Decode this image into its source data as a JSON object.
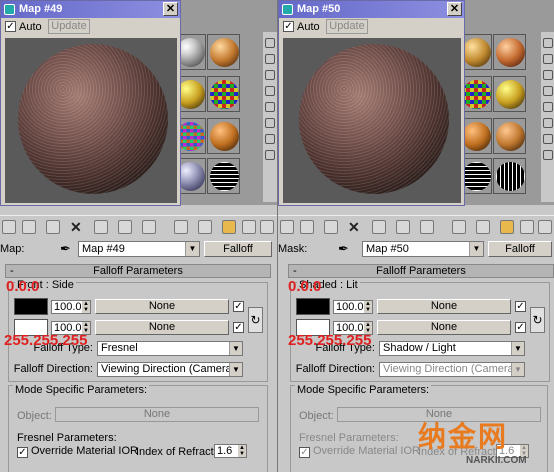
{
  "left": {
    "window_title": "Map #49",
    "auto_label": "Auto",
    "update_label": "Update",
    "close_glyph": "✕",
    "map_label": "Map:",
    "map_select": "Map #49",
    "type_button": "Falloff",
    "rollout_title": "Falloff Parameters",
    "rollout_minus": "-",
    "group_label": "Front : Side",
    "spin1": "100.0",
    "spin2": "100.0",
    "none1": "None",
    "none2": "None",
    "falloff_type_label": "Falloff Type:",
    "falloff_type_value": "Fresnel",
    "falloff_dir_label": "Falloff Direction:",
    "falloff_dir_value": "Viewing Direction (Camera Z-Axis)",
    "ann_black": "0.0.0",
    "ann_white": "255.255.255",
    "mode_title": "Mode Specific Parameters:",
    "object_label": "Object:",
    "object_value": "None",
    "fresnel_label": "Fresnel Parameters:",
    "override_label": "Override Material IOR",
    "ior_label": "Index of Refraction",
    "ior_value": "1.6"
  },
  "right": {
    "window_title": "Map #50",
    "auto_label": "Auto",
    "update_label": "Update",
    "close_glyph": "✕",
    "map_label": "Mask:",
    "map_select": "Map #50",
    "type_button": "Falloff",
    "rollout_title": "Falloff Parameters",
    "rollout_minus": "-",
    "group_label": "Shaded : Lit",
    "spin1": "100.0",
    "spin2": "100.0",
    "none1": "None",
    "none2": "None",
    "falloff_type_label": "Falloff Type:",
    "falloff_type_value": "Shadow / Light",
    "falloff_dir_label": "Falloff Direction:",
    "falloff_dir_value": "Viewing Direction (Camera Z-Axis)",
    "ann_black": "0.0.0",
    "ann_white": "255.255.255",
    "mode_title": "Mode Specific Parameters:",
    "object_label": "Object:",
    "object_value": "None",
    "fresnel_label": "Fresnel Parameters:",
    "override_label": "Override Material IOR",
    "ior_label": "Index of Refraction",
    "ior_value": "1.6"
  },
  "watermark": {
    "logo": "纳金网",
    "url": "NARKII.COM"
  },
  "colors": {
    "title_bar": "#6468c8",
    "annotation": "#e02020",
    "swatch_black": "#000000",
    "swatch_white": "#ffffff",
    "highlight_tool": "#e8b84c"
  }
}
